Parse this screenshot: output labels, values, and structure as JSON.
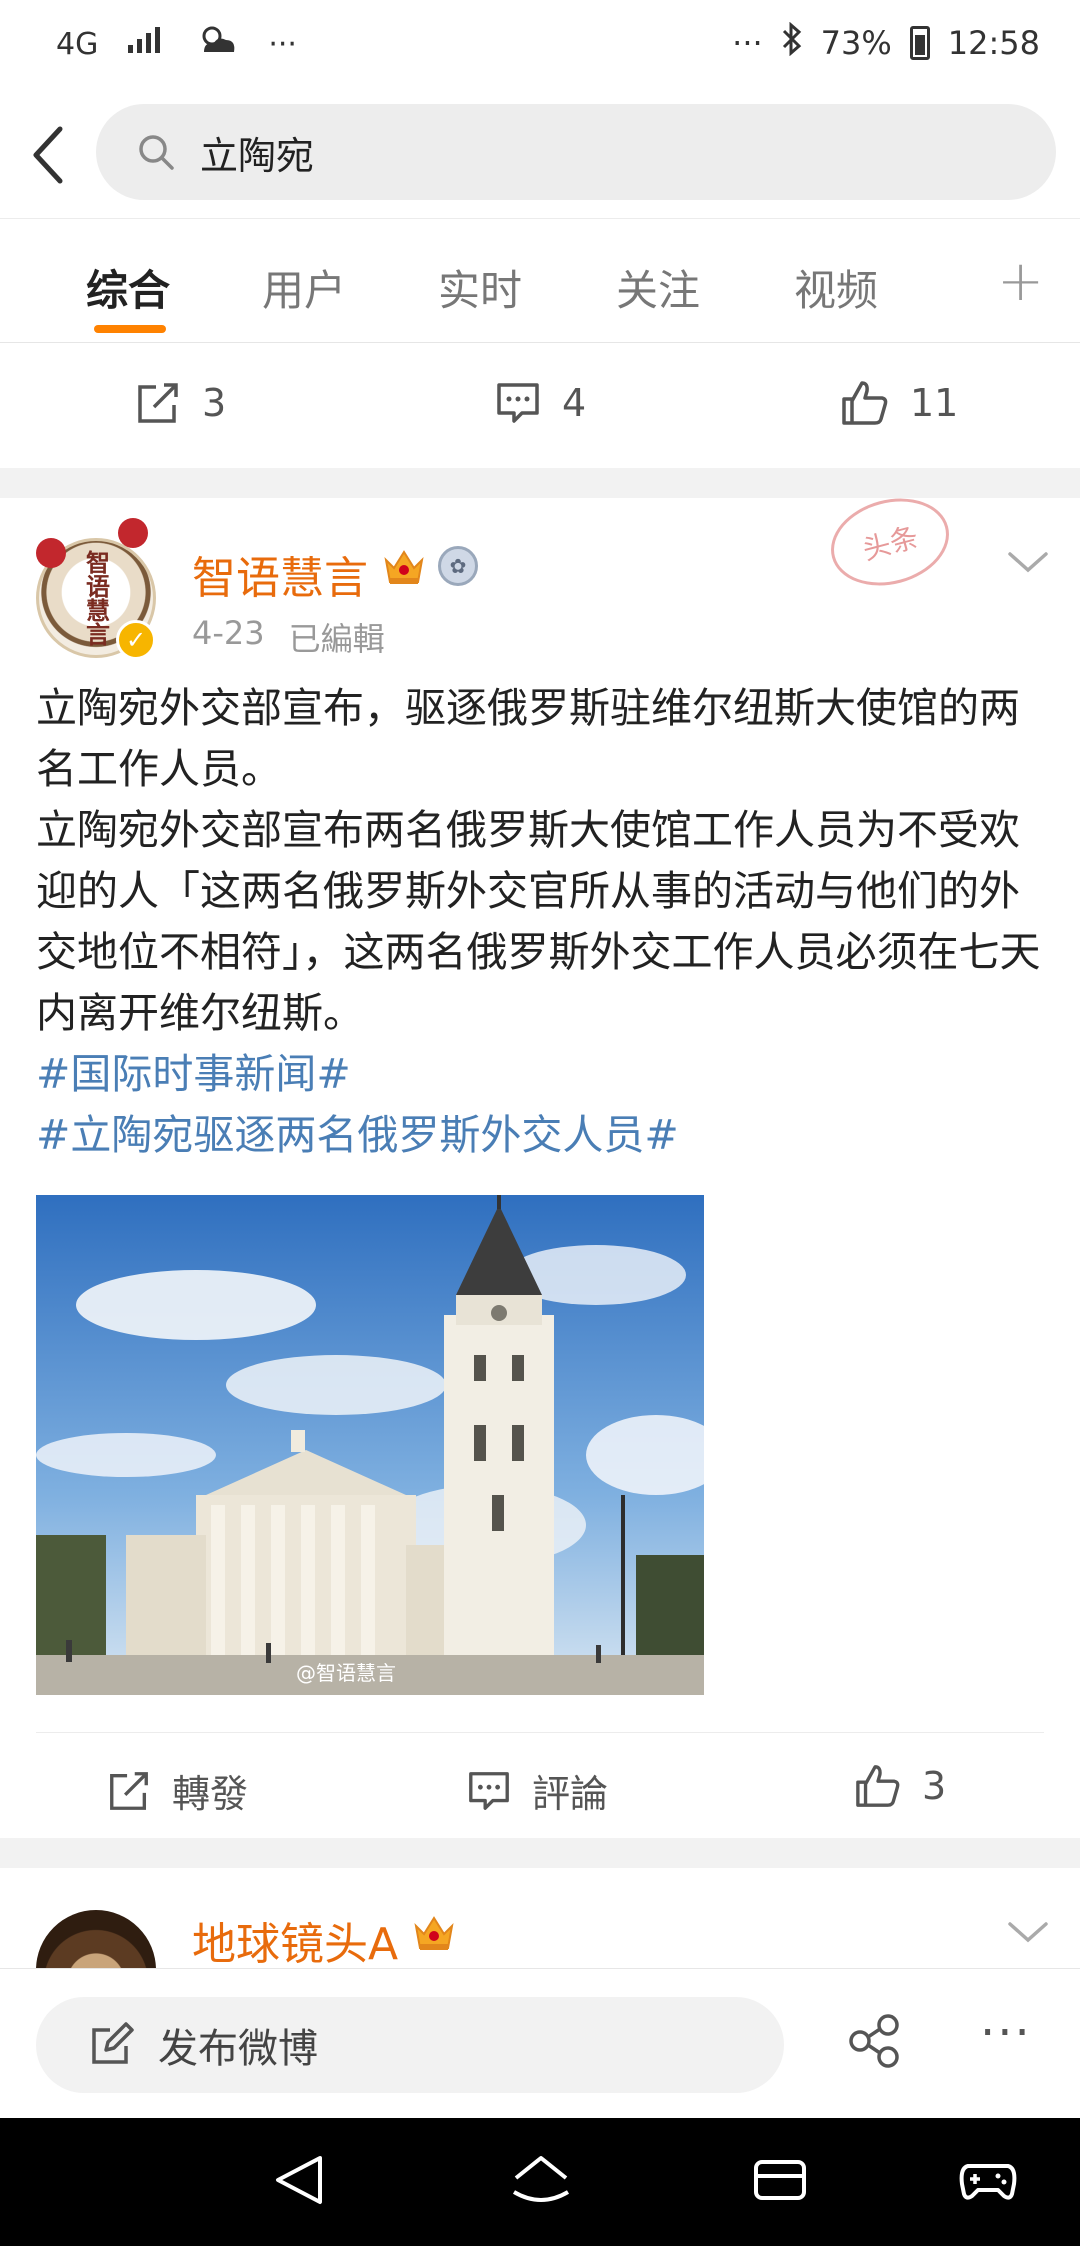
{
  "status_bar": {
    "network": "4G",
    "more_left": "···",
    "more_right": "···",
    "battery": "73%",
    "time": "12:58"
  },
  "search": {
    "query": "立陶宛"
  },
  "tabs": [
    {
      "label": "综合",
      "active": true
    },
    {
      "label": "用户",
      "active": false
    },
    {
      "label": "实时",
      "active": false
    },
    {
      "label": "关注",
      "active": false
    },
    {
      "label": "视频",
      "active": false
    }
  ],
  "tab_plus": "+",
  "prev_actions": {
    "reposts": "3",
    "comments": "4",
    "likes": "11"
  },
  "post": {
    "username": "智语慧言",
    "date": "4-23",
    "edited": "已編輯",
    "stamp": "头条",
    "avatar_text": "智语慧言",
    "paragraphs": [
      "立陶宛外交部宣布，驱逐俄罗斯驻维尔纽斯大使馆的两名工作人员。",
      "立陶宛外交部宣布两名俄罗斯大使馆工作人员为不受欢迎的人「这两名俄罗斯外交官所从事的活动与他们的外交地位不相符」，这两名俄罗斯外交工作人员必须在七天内离开维尔纽斯。"
    ],
    "hashtags": [
      "#国际时事新闻#",
      "#立陶宛驱逐两名俄罗斯外交人员#"
    ],
    "image_watermark": "@智语慧言",
    "actions": {
      "repost": "轉發",
      "comment": "評論",
      "likes": "3"
    }
  },
  "next_post": {
    "username": "地球镜头A"
  },
  "compose": {
    "placeholder": "发布微博",
    "more": "···"
  },
  "colors": {
    "accent": "#ff8200",
    "username": "#e86b0c",
    "hashtag": "#4a7eb5"
  }
}
